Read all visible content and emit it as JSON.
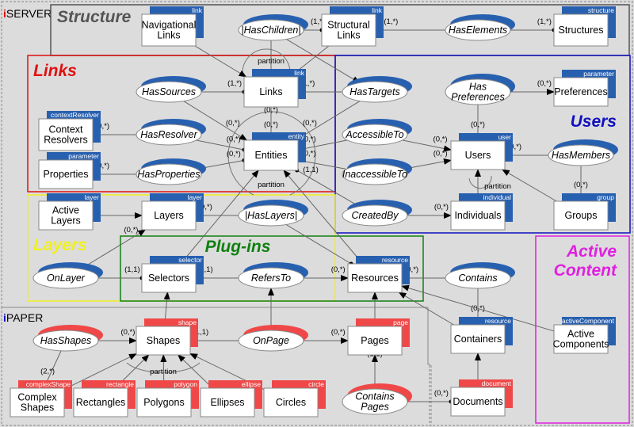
{
  "packages": [
    {
      "id": "iserver",
      "prefix": "i",
      "name": "SERVER",
      "prefix_color": "#e01010"
    },
    {
      "id": "ipaper",
      "prefix": "i",
      "name": "PAPER",
      "prefix_color": "#1010c0"
    }
  ],
  "regions": [
    {
      "id": "structure",
      "title": "Structure",
      "color": "#555555"
    },
    {
      "id": "links",
      "title": "Links",
      "color": "#e01010"
    },
    {
      "id": "users",
      "title": "Users",
      "color": "#1010c0"
    },
    {
      "id": "layers",
      "title": "Layers",
      "color": "#f0f020"
    },
    {
      "id": "plugins",
      "title": "Plug-ins",
      "color": "#108010"
    },
    {
      "id": "active",
      "title": "Active Content",
      "color": "#e020e0"
    }
  ],
  "colors": {
    "server_tag": "#2860b0",
    "paper_tag": "#f04848",
    "background": "#dcdcdc"
  },
  "entities": [
    {
      "id": "navlinks",
      "lines": [
        "Navigational",
        "Links"
      ],
      "tag": "link",
      "kind": "server"
    },
    {
      "id": "structlinks",
      "lines": [
        "Structural",
        "Links"
      ],
      "tag": "link",
      "kind": "server"
    },
    {
      "id": "structures",
      "lines": [
        "Structures"
      ],
      "tag": "structure",
      "kind": "server"
    },
    {
      "id": "links",
      "lines": [
        "Links"
      ],
      "tag": "link",
      "kind": "server"
    },
    {
      "id": "entities",
      "lines": [
        "Entities"
      ],
      "tag": "entity",
      "kind": "server"
    },
    {
      "id": "ctxres",
      "lines": [
        "Context",
        "Resolvers"
      ],
      "tag": "contextResolver",
      "kind": "server"
    },
    {
      "id": "properties",
      "lines": [
        "Properties"
      ],
      "tag": "parameter",
      "kind": "server"
    },
    {
      "id": "preferences",
      "lines": [
        "Preferences"
      ],
      "tag": "parameter",
      "kind": "server"
    },
    {
      "id": "users",
      "lines": [
        "Users"
      ],
      "tag": "user",
      "kind": "server"
    },
    {
      "id": "individuals",
      "lines": [
        "Individuals"
      ],
      "tag": "individual",
      "kind": "server"
    },
    {
      "id": "groups",
      "lines": [
        "Groups"
      ],
      "tag": "group",
      "kind": "server"
    },
    {
      "id": "activelayers",
      "lines": [
        "Active",
        "Layers"
      ],
      "tag": "layer",
      "kind": "server"
    },
    {
      "id": "layers",
      "lines": [
        "Layers"
      ],
      "tag": "layer",
      "kind": "server"
    },
    {
      "id": "selectors",
      "lines": [
        "Selectors"
      ],
      "tag": "selector",
      "kind": "server"
    },
    {
      "id": "resources",
      "lines": [
        "Resources"
      ],
      "tag": "resource",
      "kind": "server"
    },
    {
      "id": "containers",
      "lines": [
        "Containers"
      ],
      "tag": "resource",
      "kind": "server"
    },
    {
      "id": "activecomp",
      "lines": [
        "Active",
        "Components"
      ],
      "tag": "activeComponent",
      "kind": "server"
    },
    {
      "id": "shapes",
      "lines": [
        "Shapes"
      ],
      "tag": "shape",
      "kind": "paper"
    },
    {
      "id": "pages",
      "lines": [
        "Pages"
      ],
      "tag": "page",
      "kind": "paper"
    },
    {
      "id": "complexshapes",
      "lines": [
        "Complex",
        "Shapes"
      ],
      "tag": "complexShape",
      "kind": "paper"
    },
    {
      "id": "rectangles",
      "lines": [
        "Rectangles"
      ],
      "tag": "rectangle",
      "kind": "paper"
    },
    {
      "id": "polygons",
      "lines": [
        "Polygons"
      ],
      "tag": "polygon",
      "kind": "paper"
    },
    {
      "id": "ellipses",
      "lines": [
        "Ellipses"
      ],
      "tag": "ellipse",
      "kind": "paper"
    },
    {
      "id": "circles",
      "lines": [
        "Circles"
      ],
      "tag": "circle",
      "kind": "paper"
    },
    {
      "id": "documents",
      "lines": [
        "Documents"
      ],
      "tag": "document",
      "kind": "paper"
    }
  ],
  "relationships": [
    {
      "id": "haschildren",
      "lines": [
        "|HasChildren|"
      ],
      "kind": "server"
    },
    {
      "id": "haselements",
      "lines": [
        "HasElements"
      ],
      "kind": "server"
    },
    {
      "id": "hassources",
      "lines": [
        "HasSources"
      ],
      "kind": "server"
    },
    {
      "id": "hastargets",
      "lines": [
        "HasTargets"
      ],
      "kind": "server"
    },
    {
      "id": "hasresolver",
      "lines": [
        "HasResolver"
      ],
      "kind": "server"
    },
    {
      "id": "hasproperties",
      "lines": [
        "HasProperties"
      ],
      "kind": "server"
    },
    {
      "id": "haspreferences",
      "lines": [
        "Has",
        "Preferences"
      ],
      "kind": "server"
    },
    {
      "id": "accessibleto",
      "lines": [
        "AccessibleTo"
      ],
      "kind": "server"
    },
    {
      "id": "inaccessibleto",
      "lines": [
        "InaccessibleTo"
      ],
      "kind": "server"
    },
    {
      "id": "hasmembers",
      "lines": [
        "HasMembers"
      ],
      "kind": "server"
    },
    {
      "id": "createdby",
      "lines": [
        "CreatedBy"
      ],
      "kind": "server"
    },
    {
      "id": "haslayers",
      "lines": [
        "|HasLayers|"
      ],
      "kind": "server"
    },
    {
      "id": "onlayer",
      "lines": [
        "OnLayer"
      ],
      "kind": "server"
    },
    {
      "id": "refersto",
      "lines": [
        "RefersTo"
      ],
      "kind": "server"
    },
    {
      "id": "contains",
      "lines": [
        "Contains"
      ],
      "kind": "server"
    },
    {
      "id": "hasshapes",
      "lines": [
        "HasShapes"
      ],
      "kind": "paper"
    },
    {
      "id": "onpage",
      "lines": [
        "OnPage"
      ],
      "kind": "paper"
    },
    {
      "id": "containspages",
      "lines": [
        "Contains",
        "Pages"
      ],
      "kind": "paper"
    }
  ],
  "edges": [
    {
      "from": "navlinks",
      "to": "links",
      "card": "",
      "arrow": "end"
    },
    {
      "from": "structlinks",
      "to": "links",
      "card": "",
      "arrow": "end"
    },
    {
      "from": "haschildren",
      "to": "structlinks",
      "card": "(1,*)",
      "arrow": "dot"
    },
    {
      "from": "haschildren",
      "to": "entities",
      "card": "(0,*)",
      "arrow": "end"
    },
    {
      "from": "haschildren",
      "to": "hastargets",
      "card": "",
      "arrow": "end"
    },
    {
      "from": "haselements",
      "to": "structlinks",
      "card": "(1,*)",
      "arrow": "end"
    },
    {
      "from": "haselements",
      "to": "structures",
      "card": "(1,*)",
      "arrow": "dot"
    },
    {
      "from": "hassources",
      "to": "links",
      "card": "(1,*)",
      "arrow": "dot"
    },
    {
      "from": "hassources",
      "to": "entities",
      "card": "(0,*)",
      "arrow": "end"
    },
    {
      "from": "hastargets",
      "to": "links",
      "card": "(1,*)",
      "arrow": "dot"
    },
    {
      "from": "hastargets",
      "to": "entities",
      "card": "(0,*)",
      "arrow": "end"
    },
    {
      "from": "links",
      "to": "entities",
      "card": "(0,*)",
      "arrow": "end"
    },
    {
      "from": "hasresolver",
      "to": "ctxres",
      "card": "(0,*)",
      "arrow": "end"
    },
    {
      "from": "hasresolver",
      "to": "entities",
      "card": "(0,*)",
      "arrow": "dot"
    },
    {
      "from": "hasproperties",
      "to": "properties",
      "card": "(0,*)",
      "arrow": "end"
    },
    {
      "from": "hasproperties",
      "to": "entities",
      "card": "(0,*)",
      "arrow": "dot"
    },
    {
      "from": "haspreferences",
      "to": "preferences",
      "card": "(0,*)",
      "arrow": "end"
    },
    {
      "from": "haspreferences",
      "to": "users",
      "card": "(0,*)",
      "arrow": "dot"
    },
    {
      "from": "accessibleto",
      "to": "users",
      "card": "(0,*)",
      "arrow": "end"
    },
    {
      "from": "accessibleto",
      "to": "entities",
      "card": "(0,*)",
      "arrow": "dot"
    },
    {
      "from": "inaccessibleto",
      "to": "users",
      "card": "(0,*)",
      "arrow": "end"
    },
    {
      "from": "inaccessibleto",
      "to": "entities",
      "card": "(0,*)",
      "arrow": "dot"
    },
    {
      "from": "hasmembers",
      "to": "users",
      "card": "(0,*)",
      "arrow": "end"
    },
    {
      "from": "hasmembers",
      "to": "groups",
      "card": "(0,*)",
      "arrow": "dot"
    },
    {
      "from": "individuals",
      "to": "users",
      "card": "",
      "arrow": "end"
    },
    {
      "from": "groups",
      "to": "users",
      "card": "",
      "arrow": "end"
    },
    {
      "from": "createdby",
      "to": "individuals",
      "card": "(0,*)",
      "arrow": "end"
    },
    {
      "from": "createdby",
      "to": "entities",
      "card": "(1,1)",
      "arrow": "dot"
    },
    {
      "from": "activelayers",
      "to": "layers",
      "card": "",
      "arrow": "end"
    },
    {
      "from": "haslayers",
      "to": "layers",
      "card": "(0,*)",
      "arrow": "end"
    },
    {
      "from": "haslayers",
      "to": "resources",
      "card": "",
      "arrow": "dot"
    },
    {
      "from": "onlayer",
      "to": "layers",
      "card": "(0,*)",
      "arrow": "end"
    },
    {
      "from": "onlayer",
      "to": "selectors",
      "card": "(1,1)",
      "arrow": "dot"
    },
    {
      "from": "refersto",
      "to": "selectors",
      "card": "(1,1)",
      "arrow": "dot"
    },
    {
      "from": "refersto",
      "to": "resources",
      "card": "(0,*)",
      "arrow": "end"
    },
    {
      "from": "contains",
      "to": "resources",
      "card": "(0,*)",
      "arrow": "end"
    },
    {
      "from": "contains",
      "to": "containers",
      "card": "(0,*)",
      "arrow": "dot"
    },
    {
      "from": "selectors",
      "to": "entities",
      "card": "",
      "arrow": "end"
    },
    {
      "from": "resources",
      "to": "entities",
      "card": "",
      "arrow": "end"
    },
    {
      "from": "containers",
      "to": "resources",
      "card": "",
      "arrow": "end"
    },
    {
      "from": "activecomp",
      "to": "resources",
      "card": "",
      "arrow": "end"
    },
    {
      "from": "shapes",
      "to": "selectors",
      "card": "",
      "arrow": "end"
    },
    {
      "from": "onpage",
      "to": "refersto",
      "card": "",
      "arrow": "end"
    },
    {
      "from": "pages",
      "to": "resources",
      "card": "",
      "arrow": "end"
    },
    {
      "from": "hasshapes",
      "to": "shapes",
      "card": "(0,*)",
      "arrow": "end"
    },
    {
      "from": "hasshapes",
      "to": "complexshapes",
      "card": "(2,*)",
      "arrow": "dot"
    },
    {
      "from": "onpage",
      "to": "shapes",
      "card": "(1,1)",
      "arrow": "dot"
    },
    {
      "from": "onpage",
      "to": "pages",
      "card": "(0,*)",
      "arrow": "end"
    },
    {
      "from": "complexshapes",
      "to": "shapes",
      "card": "",
      "arrow": "end"
    },
    {
      "from": "rectangles",
      "to": "shapes",
      "card": "",
      "arrow": "end"
    },
    {
      "from": "polygons",
      "to": "shapes",
      "card": "",
      "arrow": "end"
    },
    {
      "from": "ellipses",
      "to": "shapes",
      "card": "",
      "arrow": "end"
    },
    {
      "from": "circles",
      "to": "shapes",
      "card": "",
      "arrow": "end"
    },
    {
      "from": "containspages",
      "to": "pages",
      "card": "(1,1)",
      "arrow": "end"
    },
    {
      "from": "containspages",
      "to": "documents",
      "card": "(0,*)",
      "arrow": "dot"
    },
    {
      "from": "documents",
      "to": "containers",
      "card": "",
      "arrow": "end"
    }
  ],
  "partitions": [
    {
      "id": "links-partition",
      "label": "partition"
    },
    {
      "id": "entities-partition",
      "label": "partition"
    },
    {
      "id": "users-partition",
      "label": "partition"
    },
    {
      "id": "shapes-partition",
      "label": "partition"
    }
  ]
}
